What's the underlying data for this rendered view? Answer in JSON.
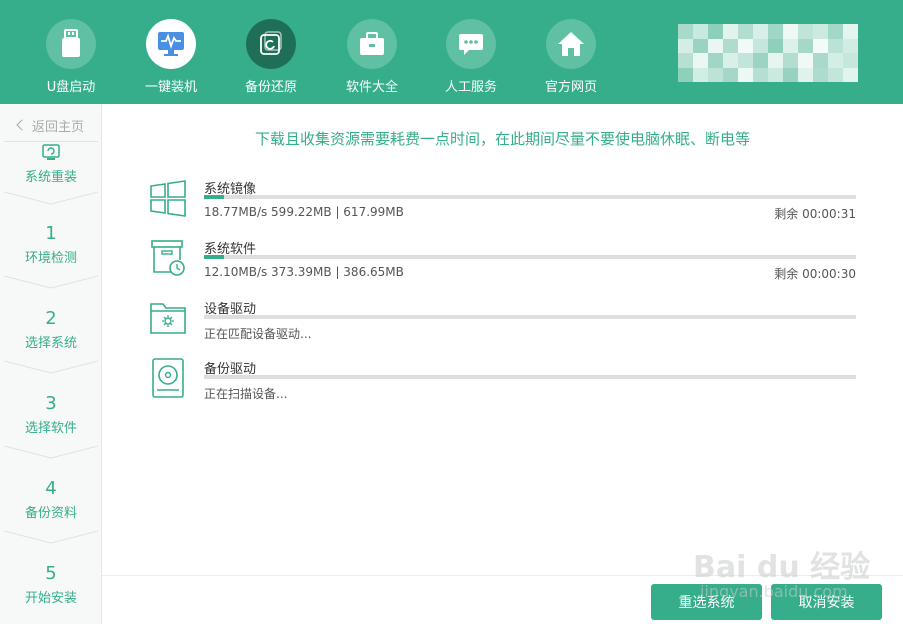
{
  "header": {
    "nav": [
      {
        "label": "U盘启动",
        "icon": "usb-drive-icon"
      },
      {
        "label": "一键装机",
        "icon": "monitor-pulse-icon"
      },
      {
        "label": "备份还原",
        "icon": "backup-restore-icon"
      },
      {
        "label": "软件大全",
        "icon": "briefcase-icon"
      },
      {
        "label": "人工服务",
        "icon": "chat-bubble-icon"
      },
      {
        "label": "官方网页",
        "icon": "home-icon"
      }
    ],
    "active_index": 1
  },
  "sidebar": {
    "back_label": "返回主页",
    "steps": [
      {
        "num": "",
        "label": "系统重装",
        "icon": "reinstall-icon"
      },
      {
        "num": "1",
        "label": "环境检测"
      },
      {
        "num": "2",
        "label": "选择系统"
      },
      {
        "num": "3",
        "label": "选择软件"
      },
      {
        "num": "4",
        "label": "备份资料"
      },
      {
        "num": "5",
        "label": "开始安装"
      }
    ]
  },
  "main": {
    "notice": "下载且收集资源需要耗费一点时间，在此期间尽量不要使电脑休眠、断电等",
    "downloads": [
      {
        "name": "系统镜像",
        "stats": "18.77MB/s 599.22MB | 617.99MB",
        "remaining": "剩余 00:00:31",
        "progress": 0.03,
        "icon": "windows-logo-icon"
      },
      {
        "name": "系统软件",
        "stats": "12.10MB/s 373.39MB | 386.65MB",
        "remaining": "剩余 00:00:30",
        "progress": 0.03,
        "icon": "software-box-clock-icon"
      },
      {
        "name": "设备驱动",
        "stats": "正在匹配设备驱动...",
        "remaining": "",
        "progress": 0,
        "icon": "driver-folder-icon"
      },
      {
        "name": "备份驱动",
        "stats": "正在扫描设备...",
        "remaining": "",
        "progress": 0,
        "icon": "hard-disk-icon"
      }
    ]
  },
  "footer": {
    "reselect_label": "重选系统",
    "cancel_label": "取消安装"
  },
  "watermark": {
    "brand": "Bai du 经验",
    "url": "jingyan.baidu.com"
  },
  "colors": {
    "accent": "#36ae8b",
    "accent_dark": "#1f6f58",
    "sidebar_bg": "#f7f8f8",
    "track": "#dcdfde"
  }
}
